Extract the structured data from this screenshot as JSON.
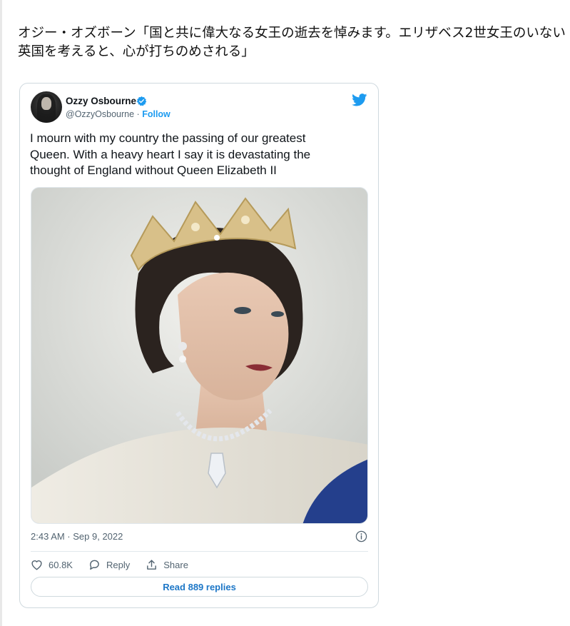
{
  "article": {
    "headline": "オジー・オズボーン「国と共に偉大なる女王の逝去を悼みます。エリザベス2世女王のいない英国を考えると、心が打ちのめされる」"
  },
  "tweet": {
    "author_name": "Ozzy Osbourne",
    "author_handle": "@OzzyOsbourne",
    "separator": "·",
    "follow_label": "Follow",
    "text": "I mourn with my country the passing of our greatest\nQueen.  With a heavy heart I say it is devastating the\nthought of England without Queen Elizabeth II",
    "timestamp": "2:43 AM · Sep 9, 2022",
    "likes": "60.8K",
    "reply_label": "Reply",
    "share_label": "Share",
    "read_replies_label": "Read 889 replies"
  },
  "colors": {
    "twitter_blue": "#1d9bf0",
    "text_primary": "#0f1419",
    "text_secondary": "#536471",
    "border": "#cfd9de"
  },
  "icons": [
    "verified-icon",
    "twitter-icon",
    "info-icon",
    "heart-icon",
    "reply-icon",
    "share-icon"
  ]
}
